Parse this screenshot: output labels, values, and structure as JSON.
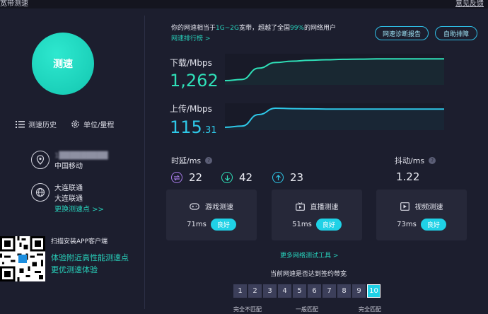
{
  "topbar": {
    "title": "宽带测速",
    "right_link": "意见反馈"
  },
  "speed_button": {
    "label": "测速"
  },
  "tools": {
    "history": "测速历史",
    "unit": "单位/量程"
  },
  "isp": {
    "ip": "1█████████",
    "name": "中国移动"
  },
  "server": {
    "line1": "大连联通",
    "line2": "大连联通",
    "change": "更换测速点 >>"
  },
  "qr": {
    "title": "扫描安装APP客户端",
    "line1": "体验附近高性能测速点",
    "line2": "更优测速体验"
  },
  "header": {
    "prefix": "你的网速相当于",
    "bandwidth": "1G~2G",
    "middle": "宽带，超越了全国",
    "percent": "99%",
    "suffix": "的网络用户",
    "rank_link": "网速排行榜 >",
    "btn_report": "网速诊断报告",
    "btn_auto": "自助排障"
  },
  "download": {
    "label": "下载/Mbps",
    "value": "1,262"
  },
  "upload": {
    "label": "上传/Mbps",
    "value_int": "115",
    "value_dec": ".31"
  },
  "latency": {
    "label": "时延/ms",
    "help": "?",
    "v1": "22",
    "v2": "42",
    "v3": "23"
  },
  "jitter": {
    "label": "抖动/ms",
    "help": "?",
    "value": "1.22"
  },
  "cards": [
    {
      "title": "游戏测速",
      "ms": "71ms",
      "badge": "良好"
    },
    {
      "title": "直播测速",
      "ms": "51ms",
      "badge": "良好"
    },
    {
      "title": "视频测速",
      "ms": "73ms",
      "badge": "良好"
    }
  ],
  "more_tools": "更多网络测试工具 >",
  "bandwidth_question": "当前网速是否达到签约带宽",
  "scale": [
    "1",
    "2",
    "3",
    "4",
    "5",
    "6",
    "7",
    "8",
    "9",
    "10"
  ],
  "scale_selected": "10",
  "scale_labels": {
    "low": "完全不匹配",
    "mid": "一般匹配",
    "high": "完全匹配"
  },
  "colors": {
    "accent": "#28d2bc",
    "download": "#2fe0b8",
    "upload": "#2ec8e8",
    "bg": "#1c1e2e"
  },
  "chart_data": {
    "type": "line",
    "series": [
      {
        "name": "下载/Mbps",
        "values": [
          0,
          0.05,
          0.55,
          0.8,
          0.86,
          0.9,
          0.92,
          0.94,
          0.95,
          0.96,
          0.96,
          0.96,
          0.96,
          0.96
        ]
      },
      {
        "name": "上传/Mbps",
        "values": [
          0,
          0.06,
          0.6,
          0.9,
          0.88,
          0.87,
          0.86,
          0.86,
          0.86,
          0.86,
          0.86,
          0.86,
          0.86,
          0.86
        ]
      }
    ]
  }
}
